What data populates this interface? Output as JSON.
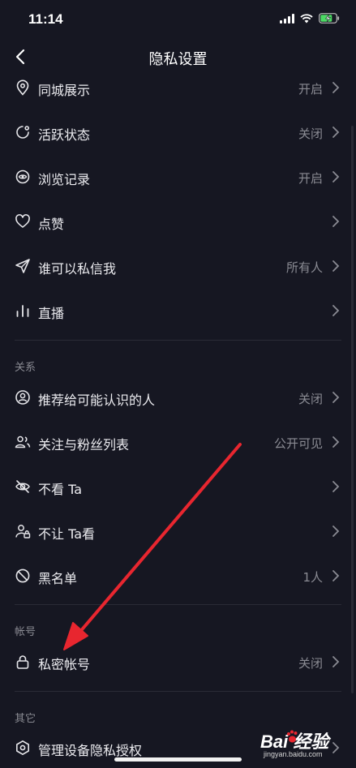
{
  "status": {
    "time": "11:14"
  },
  "nav": {
    "title": "隐私设置"
  },
  "rows": [
    {
      "label": "同城展示",
      "value": "开启",
      "icon": "location-pin-icon"
    },
    {
      "label": "活跃状态",
      "value": "关闭",
      "icon": "active-status-icon"
    },
    {
      "label": "浏览记录",
      "value": "开启",
      "icon": "eye-icon"
    },
    {
      "label": "点赞",
      "value": "",
      "icon": "heart-icon"
    },
    {
      "label": "谁可以私信我",
      "value": "所有人",
      "icon": "send-icon"
    },
    {
      "label": "直播",
      "value": "",
      "icon": "live-bars-icon"
    },
    {
      "label": "推荐给可能认识的人",
      "value": "关闭",
      "icon": "user-circle-icon"
    },
    {
      "label": "关注与粉丝列表",
      "value": "公开可见",
      "icon": "users-icon"
    },
    {
      "label": "不看 Ta",
      "value": "",
      "icon": "eye-off-icon"
    },
    {
      "label": "不让 Ta看",
      "value": "",
      "icon": "user-lock-icon"
    },
    {
      "label": "黑名单",
      "value": "1人",
      "icon": "block-icon"
    },
    {
      "label": "私密帐号",
      "value": "关闭",
      "icon": "lock-icon"
    },
    {
      "label": "管理设备隐私授权",
      "value": "",
      "icon": "hexagon-settings-icon"
    }
  ],
  "sections": {
    "relations": "关系",
    "account": "帐号",
    "other": "其它"
  },
  "watermark": {
    "main": "Bai 经验",
    "sub": "jingyan.baidu.com"
  },
  "colors": {
    "background": "#161722",
    "text": "#ececf0",
    "secondary": "#8a8b93",
    "arrow": "#e8262f"
  }
}
